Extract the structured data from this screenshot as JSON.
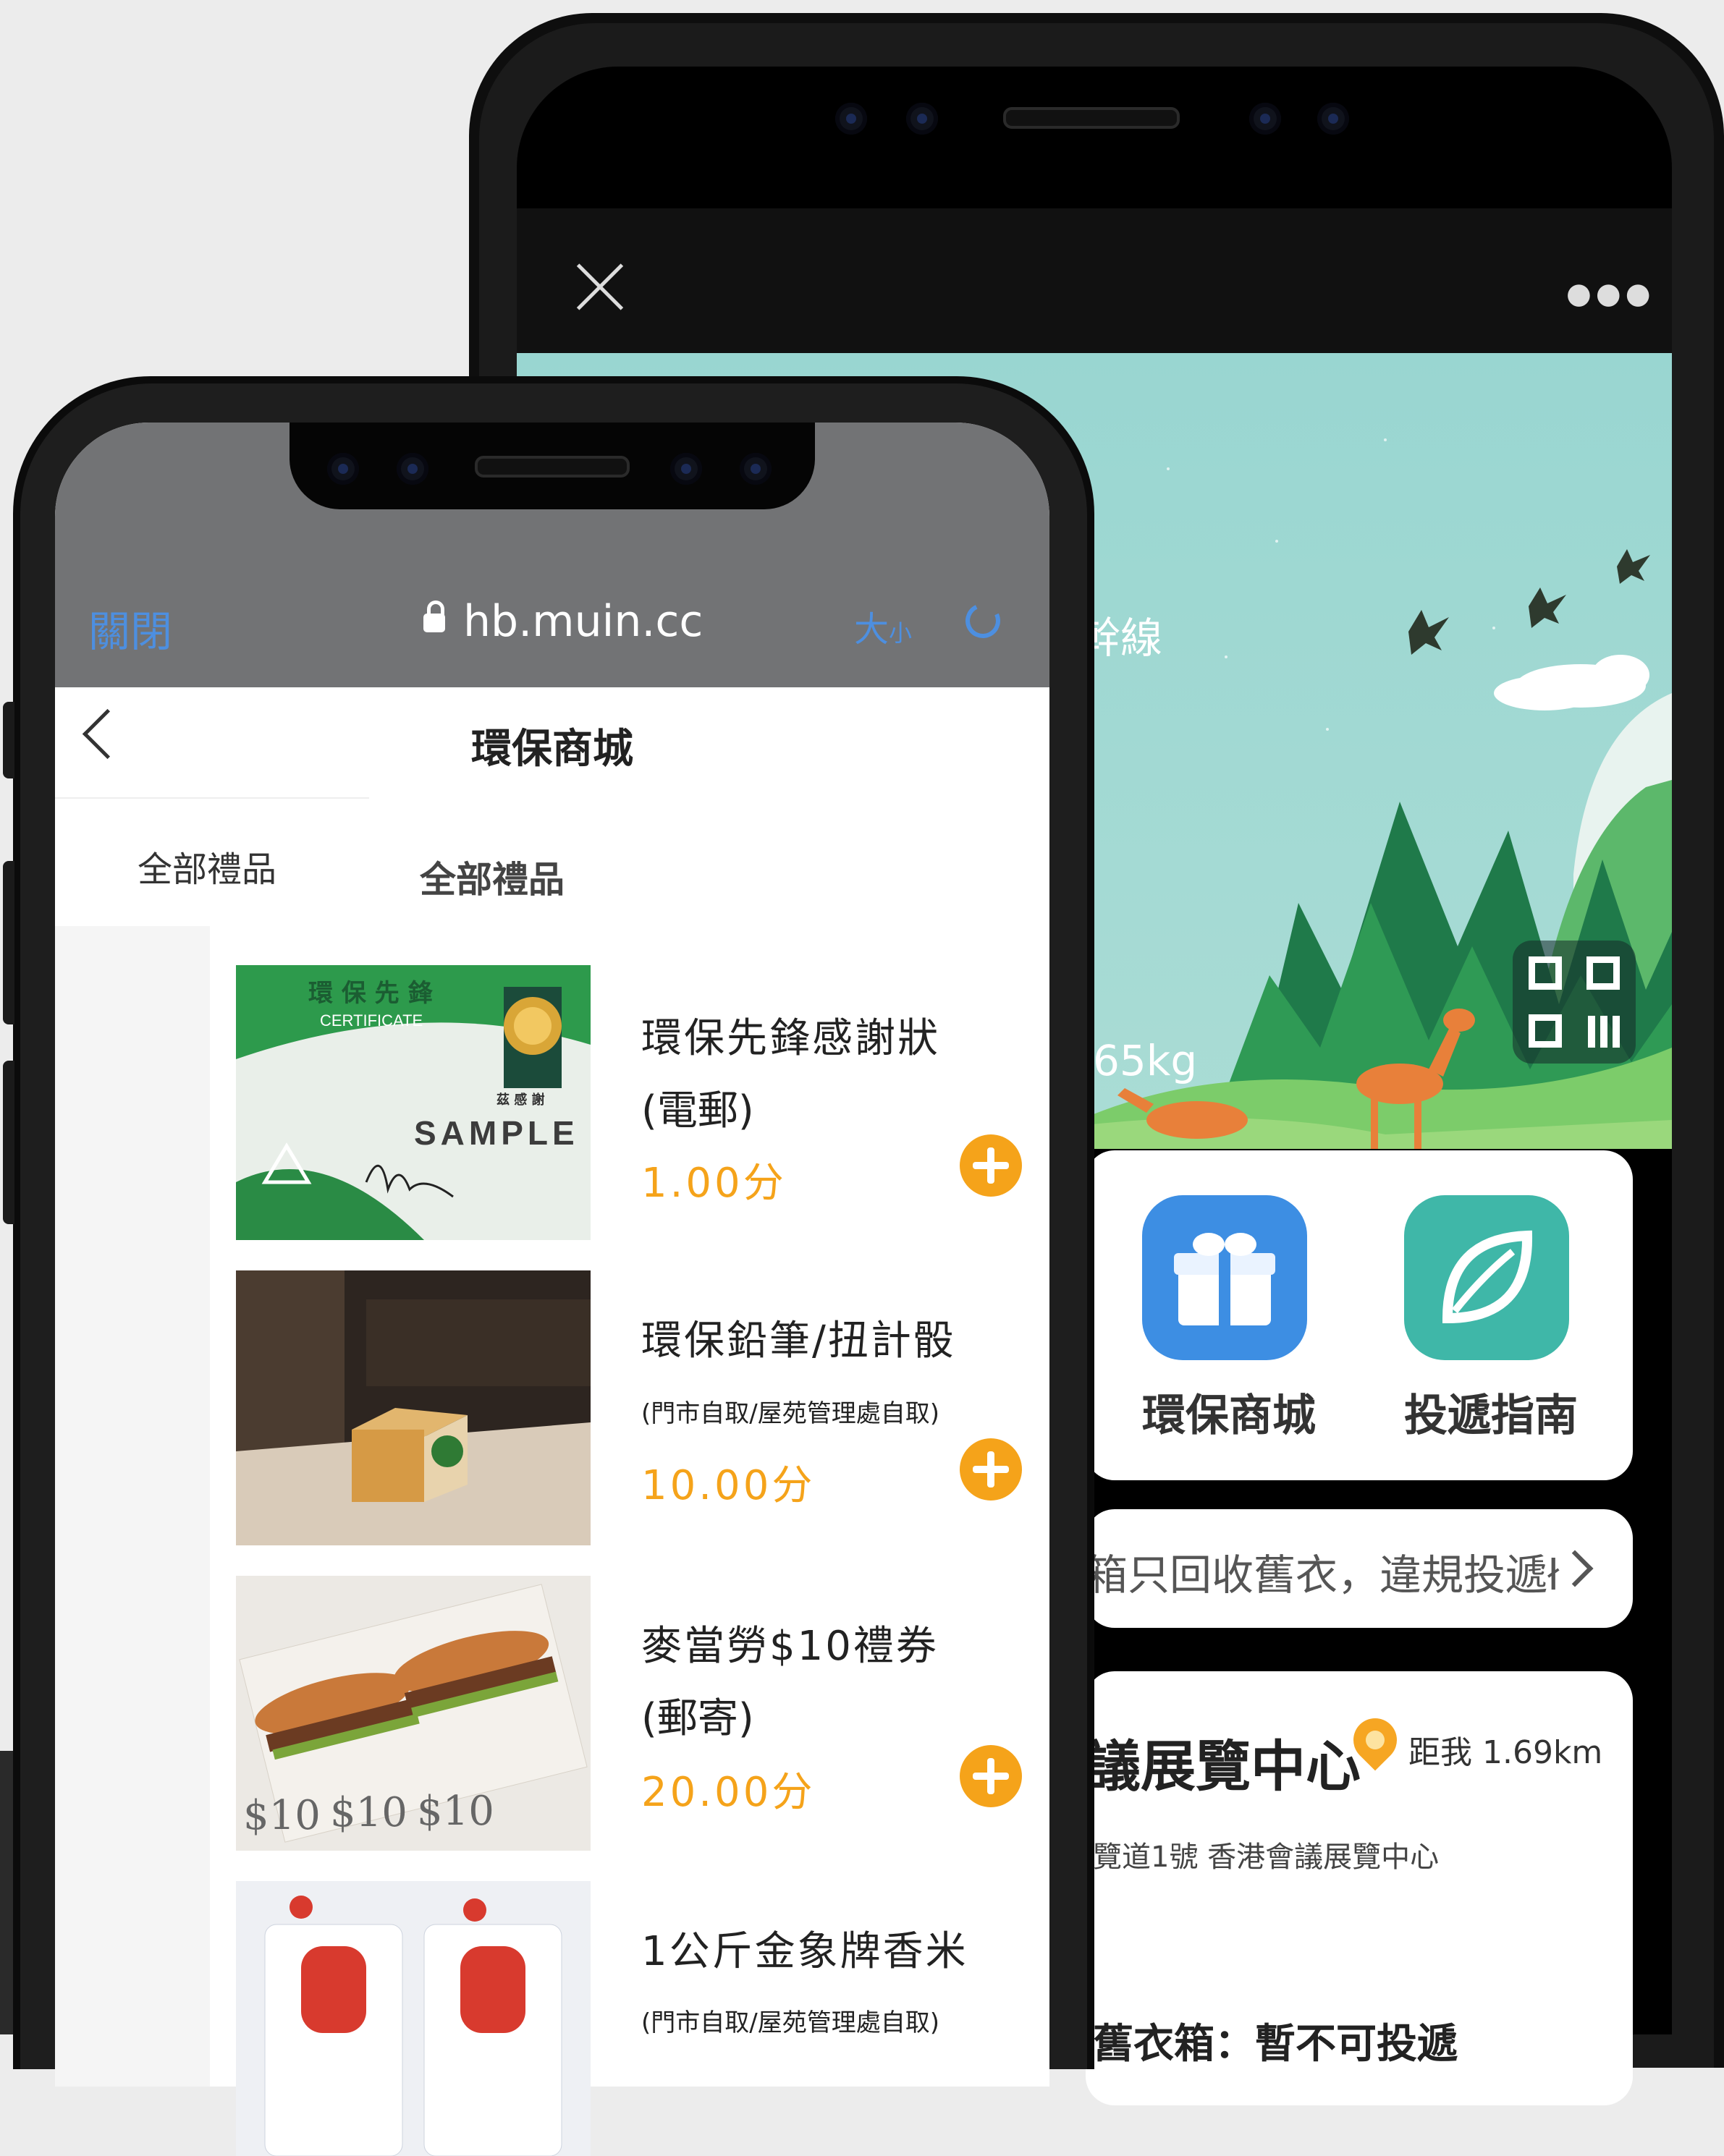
{
  "back_phone": {
    "hero": {
      "title_fragment": "幹線",
      "weight_fragment": "65kg"
    },
    "shortcuts": [
      {
        "label": "環保商城",
        "icon": "gift-icon",
        "color": "#3d8ee3"
      },
      {
        "label": "投遞指南",
        "icon": "leaf-icon",
        "color": "#3fb7a8"
      }
    ],
    "notice": {
      "text": "箱只回收舊衣，違規投遞ł"
    },
    "location": {
      "name": "議展覽中心",
      "distance": "距我 1.69km",
      "address": "覽道1號 香港會議展覽中心",
      "footer": "舊衣箱：暫不可投遞"
    }
  },
  "front_phone": {
    "browser": {
      "close_label": "關閉",
      "url": "hb.muin.cc",
      "size_label": "大",
      "size_label_small": "小"
    },
    "nav": {
      "title": "環保商城"
    },
    "sidebar": {
      "item": "全部禮品"
    },
    "category": {
      "title": "全部禮品"
    },
    "products": [
      {
        "name": "環保先鋒感謝狀",
        "sub": "(電郵)",
        "price": "1.00分",
        "image": "certificate",
        "cert": {
          "header": "環 保 先 鋒",
          "caption": "CERTIFICATE",
          "sample": "SAMPLE",
          "thanks": "茲 感 謝"
        }
      },
      {
        "name": "環保鉛筆/扭計骰",
        "sub": "(門市自取/屋苑管理處自取)",
        "price": "10.00分",
        "image": "cube"
      },
      {
        "name": "麥當勞$10禮券",
        "sub": "(郵寄)",
        "price": "20.00分",
        "image": "coupon",
        "coupon": {
          "value": "$10"
        }
      },
      {
        "name": "1公斤金象牌香米",
        "sub": "(門市自取/屋苑管理處自取)",
        "price": "",
        "image": "rice"
      }
    ],
    "colors": {
      "accent": "#f5a31a",
      "link": "#4d8fe0"
    }
  }
}
